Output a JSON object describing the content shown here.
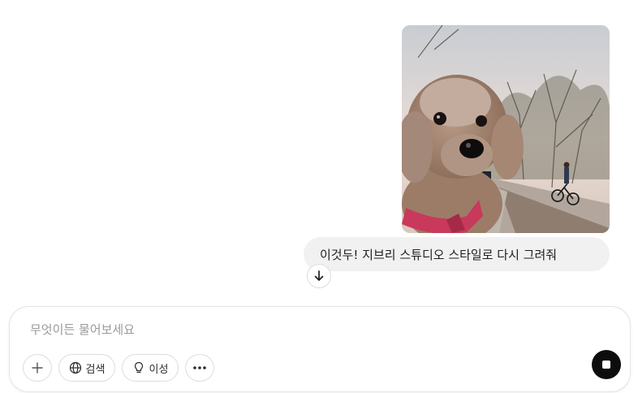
{
  "message": {
    "image_alt": "dog photo",
    "text": "이것두! 지브리 스튜디오 스타일로 다시 그려줘"
  },
  "composer": {
    "placeholder": "무엇이든 물어보세요",
    "tools": {
      "search_label": "검색",
      "reason_label": "이성"
    }
  },
  "icons": {
    "scroll_down": "arrow-down-icon",
    "plus": "plus-icon",
    "search": "globe-icon",
    "reason": "lightbulb-icon",
    "more": "more-icon",
    "stop": "stop-icon"
  }
}
